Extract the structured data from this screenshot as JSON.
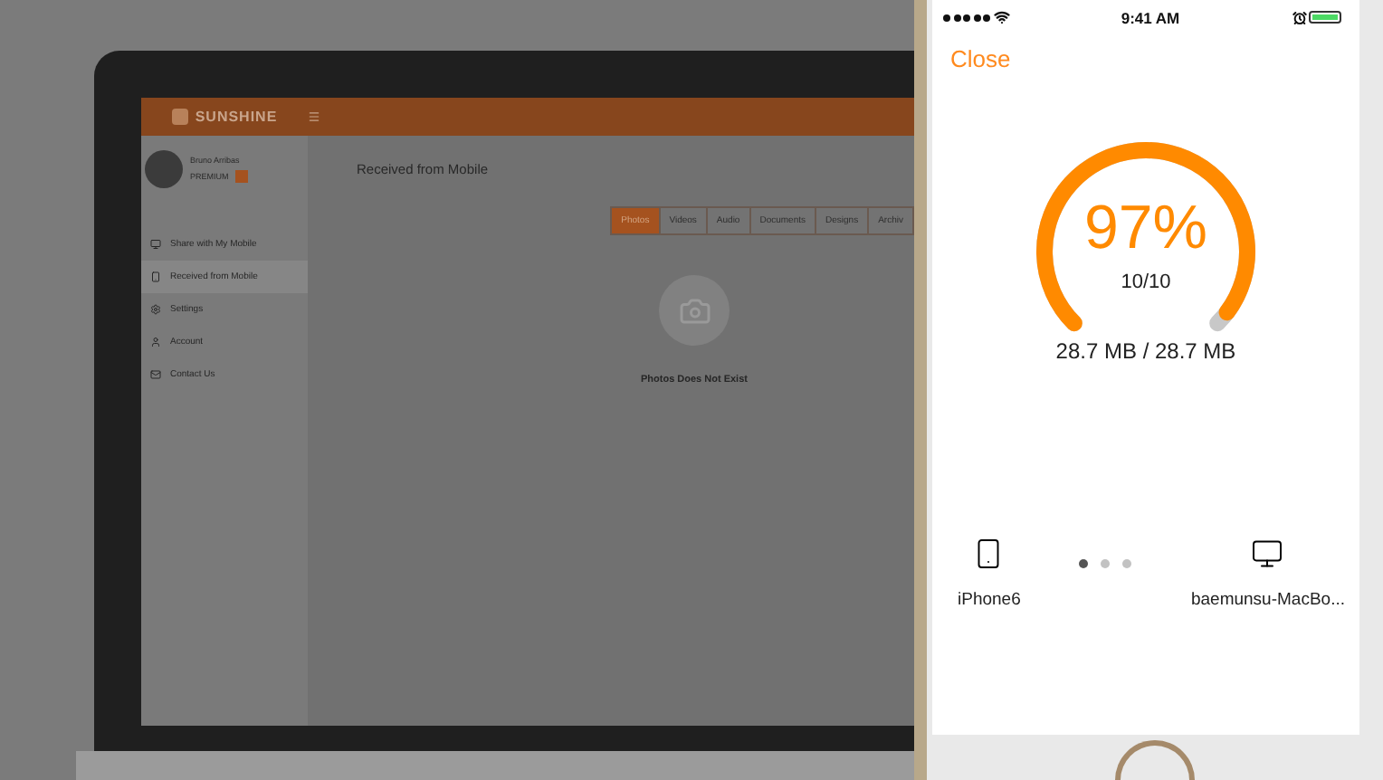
{
  "laptop_app": {
    "brand": "SUNSHINE",
    "user": {
      "name": "Bruno Arribas",
      "plan": "PREMIUM"
    },
    "nav": [
      {
        "label": "Share with My Mobile",
        "selected": false
      },
      {
        "label": "Received from Mobile",
        "selected": true
      },
      {
        "label": "Settings",
        "selected": false
      },
      {
        "label": "Account",
        "selected": false
      },
      {
        "label": "Contact Us",
        "selected": false
      }
    ],
    "page_title": "Received from Mobile",
    "tabs": [
      {
        "label": "Photos",
        "selected": true
      },
      {
        "label": "Videos",
        "selected": false
      },
      {
        "label": "Audio",
        "selected": false
      },
      {
        "label": "Documents",
        "selected": false
      },
      {
        "label": "Designs",
        "selected": false
      },
      {
        "label": "Archiv",
        "selected": false
      }
    ],
    "empty_message": "Photos Does Not Exist"
  },
  "phone": {
    "status_time": "9:41 AM",
    "close": "Close",
    "transfer": {
      "percent": "97%",
      "level": 0.97,
      "count": "10/10",
      "size": "28.7 MB / 28.7 MB"
    },
    "pager": [
      {
        "selected": true
      },
      {
        "selected": false
      },
      {
        "selected": false
      }
    ],
    "devices": [
      {
        "name": "iPhone6",
        "kind": "phone"
      },
      {
        "name": "baemunsu-MacBo...",
        "kind": "computer"
      }
    ]
  }
}
